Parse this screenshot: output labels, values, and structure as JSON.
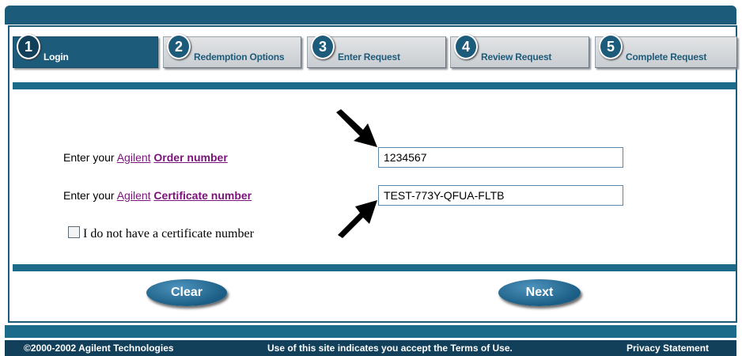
{
  "steps": [
    {
      "num": "1",
      "label": "Login"
    },
    {
      "num": "2",
      "label": "Redemption Options"
    },
    {
      "num": "3",
      "label": "Enter Request"
    },
    {
      "num": "4",
      "label": "Review Request"
    },
    {
      "num": "5",
      "label": "Complete Request"
    }
  ],
  "form": {
    "order": {
      "prefix": "Enter your",
      "link": "Agilent",
      "bold": "Order number",
      "value": "1234567"
    },
    "cert": {
      "prefix": "Enter your",
      "link": "Agilent",
      "bold": "Certificate number",
      "value": "TEST-773Y-QFUA-FLTB"
    },
    "no_cert_label": "I do not have a certificate number"
  },
  "buttons": {
    "clear": "Clear",
    "next": "Next"
  },
  "footer": {
    "copyright": "©2000-2002 Agilent Technologies",
    "terms": "Use of this site indicates you accept the Terms of Use.",
    "privacy": "Privacy Statement"
  },
  "colors": {
    "brand": "#1d5b7a",
    "link": "#7a127a"
  }
}
